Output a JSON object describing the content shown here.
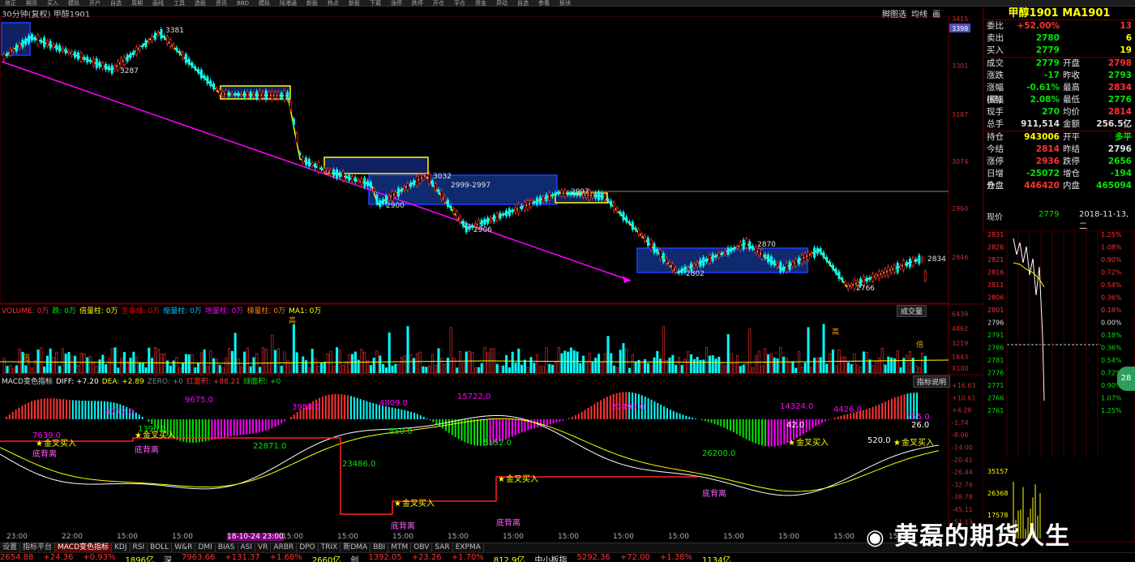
{
  "menu": {
    "items": [
      "修正",
      "期货",
      "买入",
      "模拟",
      "开户",
      "自选",
      "周期",
      "画线",
      "工具",
      "选股",
      "资讯",
      "BBD",
      "模拟",
      "陆港通",
      "新股",
      "热点",
      "新股",
      "下载",
      "涨停",
      "跌停",
      "开仓",
      "平仓",
      "资金",
      "异动",
      "自选",
      "参看",
      "板块"
    ]
  },
  "chart": {
    "header": "30分钟(复权) 甲醇1901",
    "tools": [
      "脚图选",
      "均线",
      "画"
    ],
    "price_labels": [
      "3415",
      "3398",
      "3301",
      "3187",
      "3074",
      "2960",
      "2846"
    ],
    "annotations": [
      "3381",
      "3287",
      "3032",
      "2999-2997",
      "2900",
      "2906",
      "2997",
      "2870",
      "2802",
      "2834",
      "2766"
    ],
    "hline_label": "2999-2997"
  },
  "volume": {
    "items": [
      {
        "text": "VOLUME: 0万",
        "color": "#ff3232"
      },
      {
        "text": "跌: 0万",
        "color": "#00e600"
      },
      {
        "text": "倍量柱: 0万",
        "color": "#ffff00"
      },
      {
        "text": "生命线: 0万",
        "color": "#ff0000"
      },
      {
        "text": "缩量柱: 0万",
        "color": "#00bfff"
      },
      {
        "text": "地量柱: 0万",
        "color": "#ff00ff"
      },
      {
        "text": "梯量柱: 0万",
        "color": "#ff8000"
      },
      {
        "text": "MA1: 0万",
        "color": "#ffff00"
      }
    ],
    "button": "成交量",
    "axis": [
      "6439",
      "4862",
      "3219",
      "1643",
      "X100"
    ],
    "marks": [
      "高",
      "高",
      "倍",
      "倍"
    ]
  },
  "macd": {
    "items": [
      {
        "text": "MACD变色指标",
        "color": "#e0e0e0"
      },
      {
        "text": "DIFF: +7.20",
        "color": "#ffffff"
      },
      {
        "text": "DEA: +2.89",
        "color": "#ffff00"
      },
      {
        "text": "ZERO: +0",
        "color": "#808080"
      },
      {
        "text": "红面积: +88.21",
        "color": "#ff3232"
      },
      {
        "text": "绿面积: +0",
        "color": "#00e600"
      }
    ],
    "button": "指标说明",
    "axis": [
      "+16.63",
      "+10.61",
      "+4.28",
      "-1.74",
      "-8.06",
      "-14.00",
      "-20.41",
      "-26.44",
      "-32.76",
      "-38.78",
      "-45.11",
      "-51.13"
    ],
    "values": [
      "7639.0",
      "4772.0",
      "9675.0",
      "3958.0",
      "4809.0",
      "15722.0",
      "27493.0",
      "14324.0",
      "4426.0",
      "755.0",
      "1396.0",
      "22871.0",
      "850.0",
      "23486.0",
      "5152.0",
      "26200.0",
      "42.0",
      "26.0",
      "520.0"
    ],
    "signals": [
      "金叉买入",
      "金叉买入",
      "金叉买入",
      "金叉买入",
      "金叉买入",
      "金叉买入"
    ],
    "divergences": [
      "底背离",
      "底背离",
      "底背离",
      "底背离",
      "底背离"
    ]
  },
  "time_axis": [
    "23:00",
    "22:00",
    "15:00",
    "15:00",
    "18-10-24 23:00",
    "15:00",
    "15:00",
    "15:00",
    "15:00",
    "15:00",
    "15:00",
    "15:00",
    "15:00",
    "15:00",
    "15:00",
    "15:00",
    "15:00"
  ],
  "tabs": [
    "设置",
    "指标平台",
    "MACD变色指标",
    "KDJ",
    "RSI",
    "BOLL",
    "W&R",
    "DMI",
    "BIAS",
    "ASI",
    "VR",
    "ARBR",
    "DPO",
    "TRIX",
    "新DMA",
    "BBI",
    "MTM",
    "OBV",
    "SAR",
    "EXPMA"
  ],
  "ticker": [
    {
      "text": "2654.88",
      "color": "#ff3232"
    },
    {
      "text": "+24.36",
      "color": "#ff3232"
    },
    {
      "text": "+0.93%",
      "color": "#ff3232"
    },
    {
      "text": "1896亿",
      "color": "#ffff00"
    },
    {
      "text": "深",
      "color": "#e0e0e0"
    },
    {
      "text": "7963.66",
      "color": "#ff3232"
    },
    {
      "text": "+131.37",
      "color": "#ff3232"
    },
    {
      "text": "+1.68%",
      "color": "#ff3232"
    },
    {
      "text": "2660亿",
      "color": "#ffff00"
    },
    {
      "text": "创",
      "color": "#e0e0e0"
    },
    {
      "text": "1392.05",
      "color": "#ff3232"
    },
    {
      "text": "+23.26",
      "color": "#ff3232"
    },
    {
      "text": "+1.70%",
      "color": "#ff3232"
    },
    {
      "text": "812.9亿",
      "color": "#ffff00"
    },
    {
      "text": "中小板指",
      "color": "#e0e0e0"
    },
    {
      "text": "5292.36",
      "color": "#ff3232"
    },
    {
      "text": "+72.00",
      "color": "#ff3232"
    },
    {
      "text": "+1.38%",
      "color": "#ff3232"
    },
    {
      "text": "1134亿",
      "color": "#ffff00"
    }
  ],
  "quote": {
    "title": "甲醇1901 MA1901",
    "rows_top": [
      {
        "l": "委比",
        "v1": "+52.00%",
        "c1": "#ff3232",
        "l2": "",
        "v2": "13",
        "c2": "#ff3232"
      },
      {
        "l": "卖出",
        "v1": "2780",
        "c1": "#00e600",
        "l2": "",
        "v2": "6",
        "c2": "#ffff00"
      },
      {
        "l": "买入",
        "v1": "2779",
        "c1": "#00e600",
        "l2": "",
        "v2": "19",
        "c2": "#ffff00"
      }
    ],
    "rows_mid": [
      {
        "l": "成交",
        "v1": "2779",
        "c1": "#00e600",
        "l2": "开盘",
        "v2": "2798",
        "c2": "#ff3232"
      },
      {
        "l": "涨跌",
        "v1": "-17",
        "c1": "#00e600",
        "l2": "昨收",
        "v2": "2793",
        "c2": "#00e600"
      },
      {
        "l": "涨幅(结)",
        "v1": "-0.61%",
        "c1": "#00e600",
        "l2": "最高",
        "v2": "2834",
        "c2": "#ff3232"
      },
      {
        "l": "振幅",
        "v1": "2.08%",
        "c1": "#00e600",
        "l2": "最低",
        "v2": "2776",
        "c2": "#00e600"
      },
      {
        "l": "现手",
        "v1": "270",
        "c1": "#00e600",
        "l2": "均价",
        "v2": "2814",
        "c2": "#ff3232"
      },
      {
        "l": "总手",
        "v1": "911,514",
        "c1": "#e0e0e0",
        "l2": "金额",
        "v2": "256.5亿",
        "c2": "#e0e0e0"
      }
    ],
    "rows_bot": [
      {
        "l": "持仓",
        "v1": "943006",
        "c1": "#ffff00",
        "l2": "开平",
        "v2": "多平",
        "c2": "#00e600"
      },
      {
        "l": "今结",
        "v1": "2814",
        "c1": "#ff3232",
        "l2": "昨结",
        "v2": "2796",
        "c2": "#e0e0e0"
      },
      {
        "l": "涨停",
        "v1": "2936",
        "c1": "#ff3232",
        "l2": "跌停",
        "v2": "2656",
        "c2": "#00e600"
      },
      {
        "l": "日增仓",
        "v1": "-25072",
        "c1": "#00e600",
        "l2": "增仓",
        "v2": "-194",
        "c2": "#00e600"
      },
      {
        "l": "外盘",
        "v1": "446420",
        "c1": "#ff3232",
        "l2": "内盘",
        "v2": "465094",
        "c2": "#00e600"
      }
    ],
    "now_label": "现价",
    "now_price": "2779",
    "now_date": "2018-11-13,二"
  },
  "mini": {
    "left_axis": [
      "2831",
      "2826",
      "2821",
      "2816",
      "2811",
      "2806",
      "2801",
      "2796",
      "2791",
      "2786",
      "2781",
      "2776",
      "2771",
      "2766",
      "2761",
      "35157",
      "26368",
      "17578"
    ],
    "right_axis": [
      "1.25%",
      "1.08%",
      "0.90%",
      "0.72%",
      "0.54%",
      "0.36%",
      "0.18%",
      "0.00%",
      "0.18%",
      "0.36%",
      "0.54%",
      "0.72%",
      "0.90%",
      "1.07%",
      "1.25%"
    ],
    "badge": "28"
  },
  "watermark": "黄磊的期货人生"
}
